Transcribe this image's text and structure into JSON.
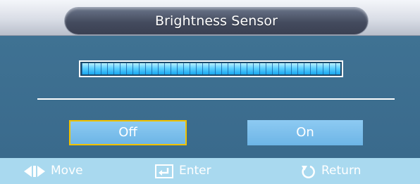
{
  "header": {
    "title": "Brightness Sensor"
  },
  "level_bar": {
    "level_percent": 100
  },
  "options": [
    {
      "label": "Off",
      "selected": true
    },
    {
      "label": "On",
      "selected": false
    }
  ],
  "footer": {
    "move": {
      "icon": "left-right-arrows-icon",
      "label": "Move"
    },
    "enter": {
      "icon": "enter-icon",
      "label": "Enter"
    },
    "return": {
      "icon": "return-icon",
      "label": "Return"
    }
  },
  "colors": {
    "panel": "#3a6a8c",
    "option": "#7bbfec",
    "selected_border": "#f2c200",
    "footer": "#a9d9ef"
  }
}
